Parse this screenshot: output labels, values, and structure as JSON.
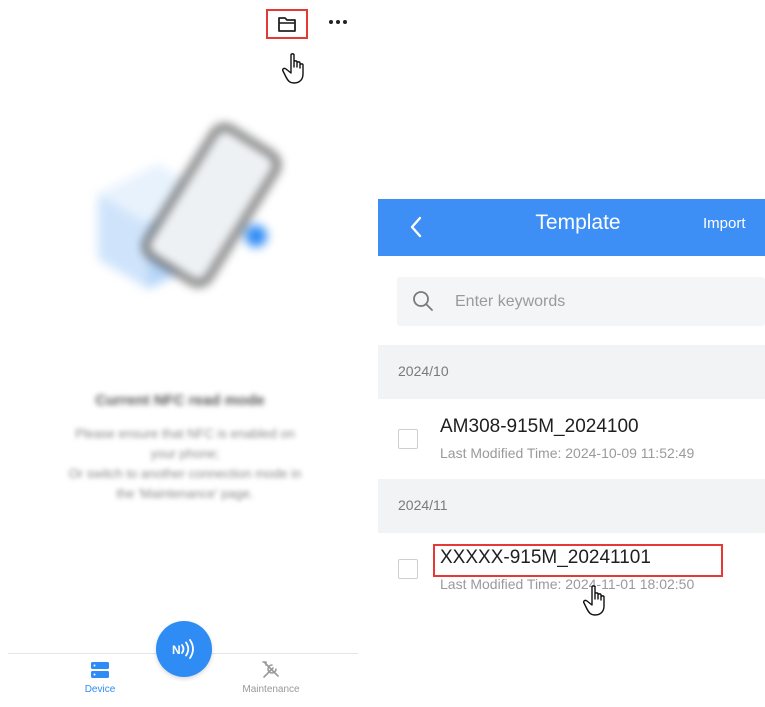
{
  "left_screen": {
    "toolbar": {
      "folder_icon": "folder-icon",
      "more_icon": "more-dots-icon"
    },
    "nfc_prompt": {
      "title": "Current NFC read mode",
      "line1": "Please ensure that NFC is enabled on",
      "line2": "your phone;",
      "line3": "Or switch to another connection mode in",
      "line4": "the 'Maintenance' page."
    },
    "bottom_nav": {
      "device_label": "Device",
      "maintenance_label": "Maintenance",
      "nfc_fab_icon": "nfc-icon"
    }
  },
  "right_screen": {
    "header": {
      "title": "Template",
      "import_label": "Import",
      "back_icon": "chevron-left-icon"
    },
    "search": {
      "placeholder": "Enter keywords"
    },
    "groups": [
      {
        "label": "2024/10",
        "items": [
          {
            "name": "AM308-915M_2024100",
            "time": "Last Modified Time: 2024-10-09 11:52:49"
          }
        ]
      },
      {
        "label": "2024/11",
        "items": [
          {
            "name": "XXXXX-915M_20241101",
            "time": "Last Modified Time: 2024-11-01 18:02:50"
          }
        ]
      }
    ]
  },
  "colors": {
    "header_blue": "#3d8ef5",
    "fab_blue": "#2f8cf5",
    "highlight_red": "#e53935"
  }
}
